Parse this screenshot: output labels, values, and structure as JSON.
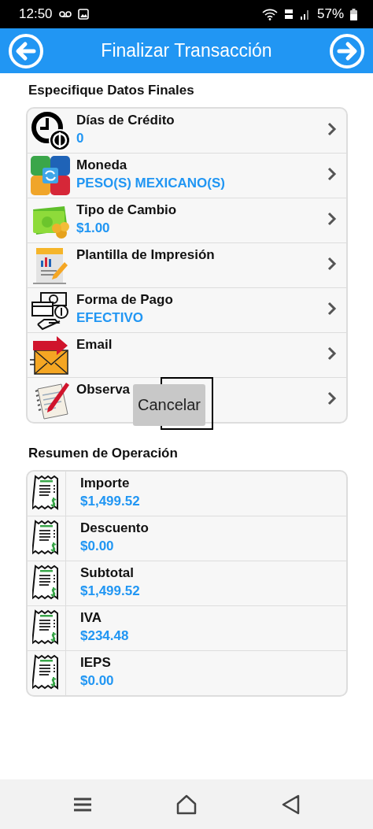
{
  "status_bar": {
    "time": "12:50",
    "battery": "57%"
  },
  "header": {
    "title": "Finalizar Transacción"
  },
  "details": {
    "title": "Especifique Datos Finales",
    "rows": [
      {
        "label": "Días de Crédito",
        "value": "0"
      },
      {
        "label": "Moneda",
        "value": "PESO(S) MEXICANO(S)"
      },
      {
        "label": "Tipo de Cambio",
        "value": "$1.00"
      },
      {
        "label": "Plantilla de Impresión"
      },
      {
        "label": "Forma de Pago",
        "value": "EFECTIVO"
      },
      {
        "label": "Email"
      },
      {
        "label": "Observa"
      }
    ]
  },
  "toast": {
    "label": "Cancelar"
  },
  "summary": {
    "title": "Resumen de Operación",
    "rows": [
      {
        "label": "Importe",
        "value": "$1,499.52"
      },
      {
        "label": "Descuento",
        "value": "$0.00"
      },
      {
        "label": "Subtotal",
        "value": "$1,499.52"
      },
      {
        "label": "IVA",
        "value": "$234.48"
      },
      {
        "label": "IEPS",
        "value": "$0.00"
      }
    ]
  }
}
